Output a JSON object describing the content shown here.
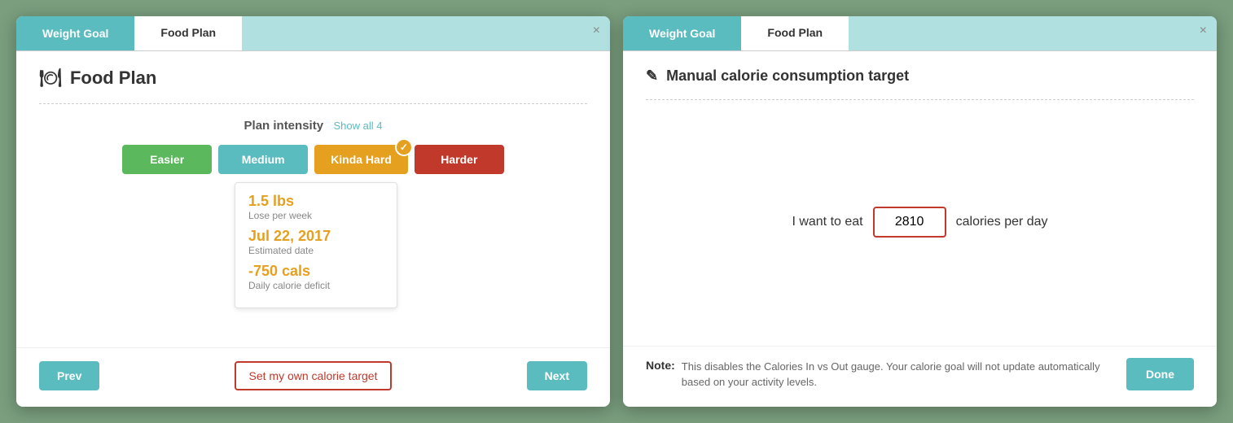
{
  "left_dialog": {
    "tab_weight_goal": "Weight Goal",
    "tab_food_plan": "Food Plan",
    "title": "Food Plan",
    "plan_intensity_label": "Plan intensity",
    "show_all_link": "Show all 4",
    "buttons": [
      {
        "id": "easier",
        "label": "Easier",
        "class": "btn-easier"
      },
      {
        "id": "medium",
        "label": "Medium",
        "class": "btn-medium"
      },
      {
        "id": "kinda-hard",
        "label": "Kinda Hard",
        "class": "btn-kinda-hard",
        "selected": true
      },
      {
        "id": "harder",
        "label": "Harder",
        "class": "btn-harder"
      }
    ],
    "details": {
      "lbs_value": "1.5 lbs",
      "lbs_label": "Lose per week",
      "date_value": "Jul 22, 2017",
      "date_label": "Estimated date",
      "cals_value": "-750 cals",
      "cals_label": "Daily calorie deficit"
    },
    "footer": {
      "prev_label": "Prev",
      "set_calorie_label": "Set my own calorie target",
      "next_label": "Next"
    }
  },
  "right_dialog": {
    "tab_weight_goal": "Weight Goal",
    "tab_food_plan": "Food Plan",
    "title": "Manual calorie consumption target",
    "edit_icon": "✎",
    "label_before": "I want to eat",
    "calorie_value": "2810",
    "label_after": "calories per day",
    "note_label": "Note:",
    "note_text": "This disables the Calories In vs Out gauge. Your calorie goal will not update automatically based on your activity levels.",
    "done_label": "Done"
  }
}
